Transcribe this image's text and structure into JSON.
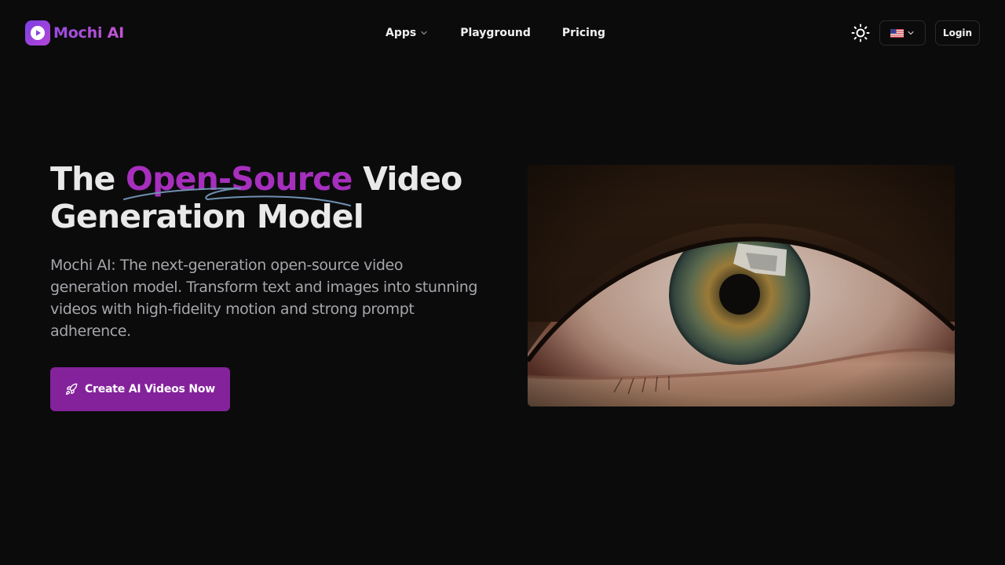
{
  "header": {
    "brand": "Mochi AI",
    "nav": [
      {
        "label": "Apps"
      },
      {
        "label": "Playground"
      },
      {
        "label": "Pricing"
      }
    ],
    "login_label": "Login"
  },
  "hero": {
    "title_prefix": "The ",
    "title_highlight": "Open-Source",
    "title_suffix": " Video Generation Model",
    "description": "Mochi AI: The next-generation open-source video generation model. Transform text and images into stunning videos with high-fidelity motion and strong prompt adherence.",
    "cta_label": "Create AI Videos Now"
  },
  "colors": {
    "background": "#0b0b0c",
    "accent": "#84229b",
    "highlight": "#a62fbd",
    "scribble": "#6f8fb0"
  },
  "icons": {
    "logo": "play-icon",
    "apps_chevron": "chevron-down-icon",
    "theme": "sun-icon",
    "language_flag": "us-flag-icon",
    "language_chevron": "chevron-down-icon",
    "cta": "rocket-icon"
  }
}
